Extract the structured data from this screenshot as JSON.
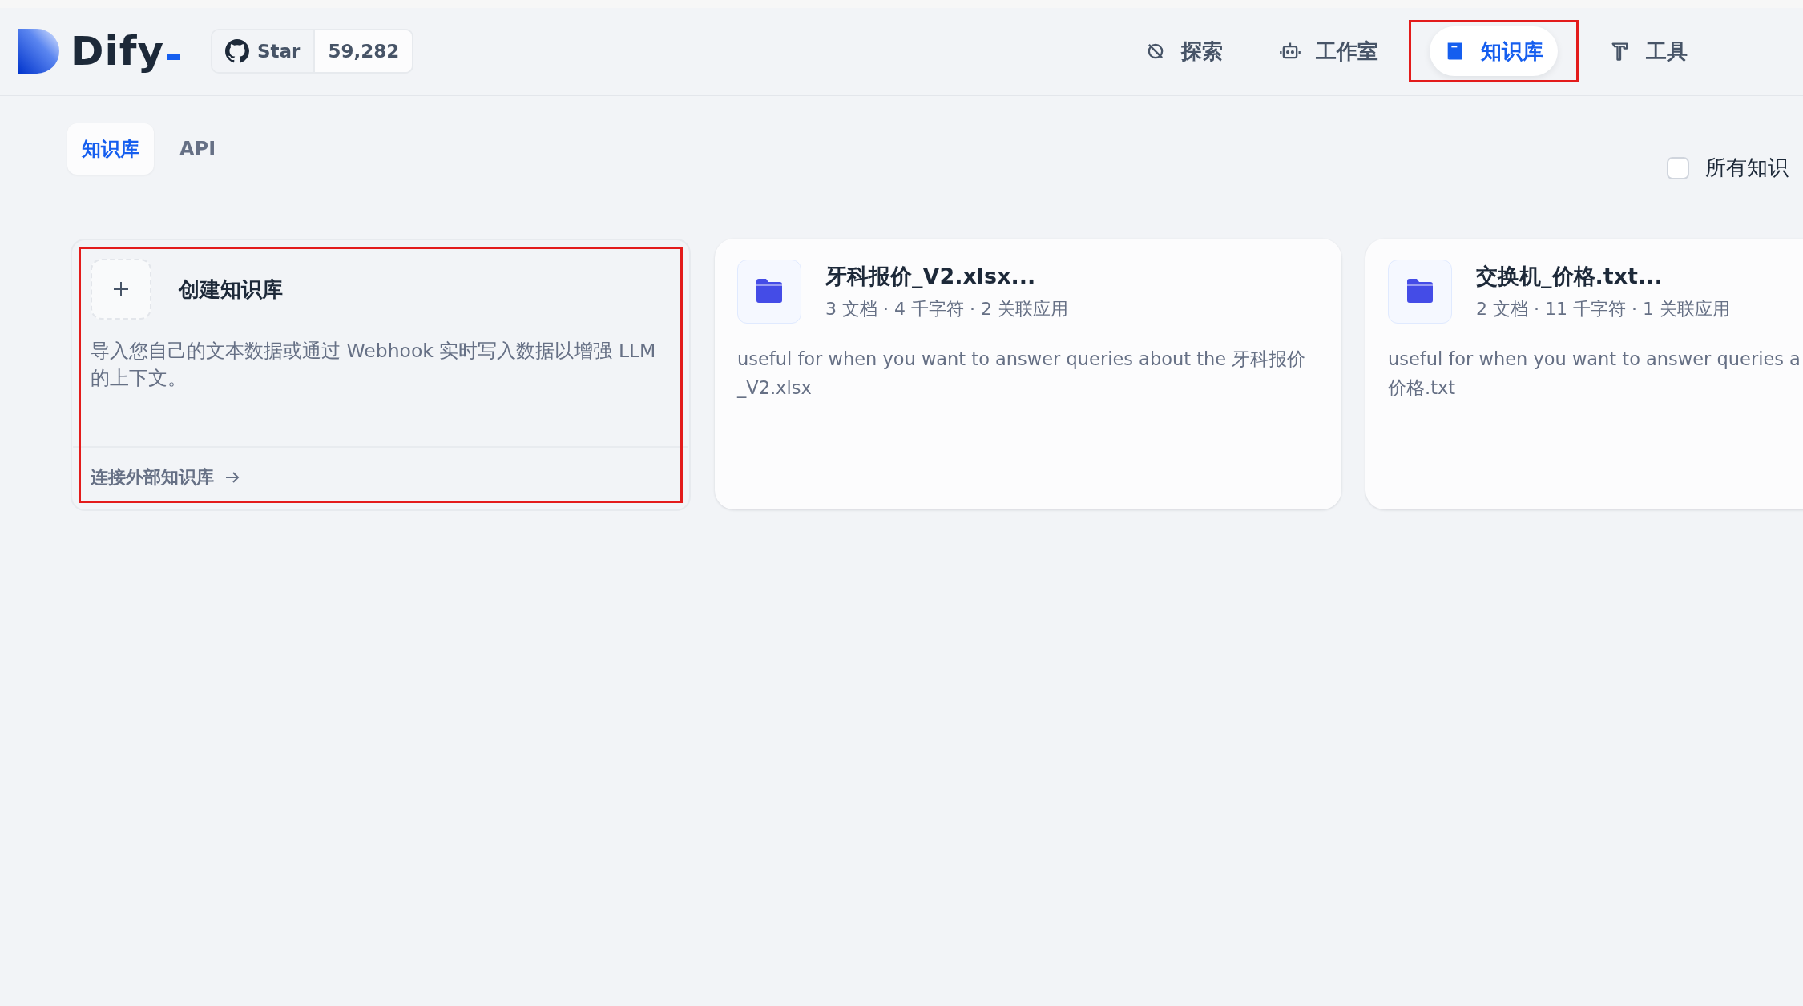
{
  "header": {
    "brand": "Dify",
    "github": {
      "label": "Star",
      "count": "59,282"
    },
    "nav": [
      {
        "kind": "explore",
        "label": "探索",
        "selected": false,
        "highlighted": false
      },
      {
        "kind": "studio",
        "label": "工作室",
        "selected": false,
        "highlighted": false
      },
      {
        "kind": "knowledge",
        "label": "知识库",
        "selected": true,
        "highlighted": true
      },
      {
        "kind": "tools",
        "label": "工具",
        "selected": false,
        "highlighted": false
      }
    ]
  },
  "tabs": [
    {
      "label": "知识库",
      "selected": true
    },
    {
      "label": "API",
      "selected": false
    }
  ],
  "filter": {
    "label": "所有知识",
    "checked": false
  },
  "create_card": {
    "title": "创建知识库",
    "description": "导入您自己的文本数据或通过 Webhook 实时写入数据以增强 LLM 的上下文。",
    "link": "连接外部知识库",
    "highlighted": true
  },
  "datasets": [
    {
      "title": "牙科报价_V2.xlsx...",
      "meta": "3 文档 · 4 千字符 · 2 关联应用",
      "description_lines": [
        "useful for when you want to answer queries about the 牙科报价",
        "_V2.xlsx"
      ]
    },
    {
      "title": "交换机_价格.txt...",
      "meta": "2 文档 · 11 千字符 · 1 关联应用",
      "description_lines": [
        "useful for when you want to answer queries a",
        "价格.txt"
      ]
    }
  ]
}
